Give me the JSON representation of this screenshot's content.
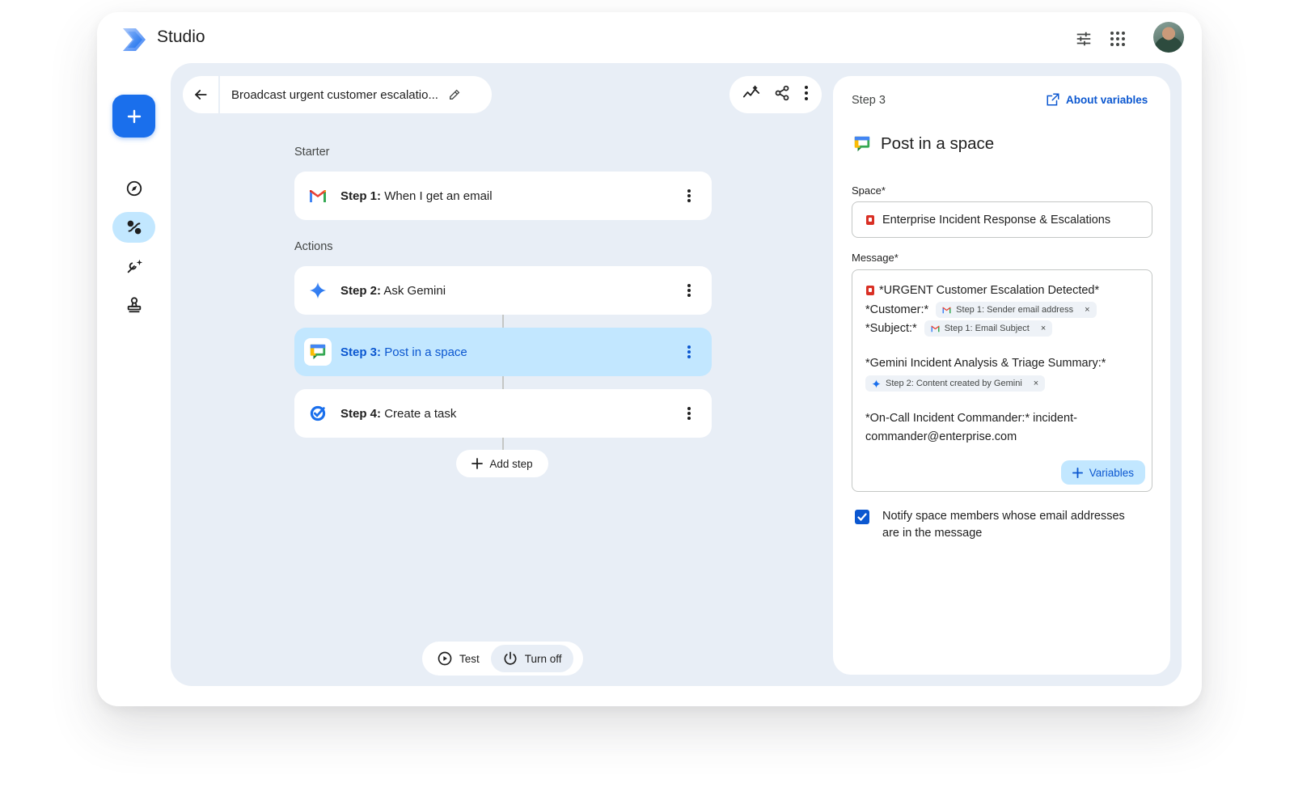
{
  "header": {
    "app_title": "Studio",
    "icons": [
      "tune-icon",
      "apps-grid-icon",
      "avatar"
    ]
  },
  "rail": {
    "new_icon": "plus-icon",
    "items": [
      "explore-icon",
      "flows-icon",
      "tools-icon",
      "stamp-icon"
    ],
    "active_item": "flows-icon"
  },
  "flow": {
    "title": "Broadcast urgent customer escalatio...",
    "starter_label": "Starter",
    "actions_label": "Actions",
    "steps": [
      {
        "label": "Step 1:",
        "text": "When I get an email",
        "icon": "gmail-icon"
      },
      {
        "label": "Step 2:",
        "text": "Ask Gemini",
        "icon": "gemini-icon"
      },
      {
        "label": "Step 3:",
        "text": "Post in a space",
        "icon": "chat-icon"
      },
      {
        "label": "Step 4:",
        "text": "Create a task",
        "icon": "tasks-icon"
      }
    ],
    "add_step_label": "Add step",
    "test_label": "Test",
    "turn_off_label": "Turn off"
  },
  "panel": {
    "step_label": "Step 3",
    "about_label": "About variables",
    "title": "Post in a space",
    "space_label": "Space*",
    "space_value": "Enterprise Incident Response & Escalations",
    "message_label": "Message*",
    "message": {
      "line1": "*URGENT Customer Escalation Detected*",
      "customer_label": "*Customer:*",
      "customer_chip": "Step 1: Sender email address",
      "subject_label": "*Subject:*",
      "subject_chip": "Step 1: Email Subject",
      "gemini_label": "*Gemini Incident Analysis & Triage Summary:*",
      "gemini_chip": "Step 2: Content created by Gemini",
      "oncall_line1": "*On-Call Incident Commander:* incident-",
      "oncall_line2": "commander@enterprise.com",
      "chip_remove": "×"
    },
    "variables_label": "Variables",
    "notify_text": "Notify space members whose email addresses are in the message",
    "notify_checked": true
  },
  "colors": {
    "accent": "#1a6fec",
    "selected": "#c2e7ff",
    "canvas": "#e8eef6",
    "link": "#0b57d0"
  }
}
